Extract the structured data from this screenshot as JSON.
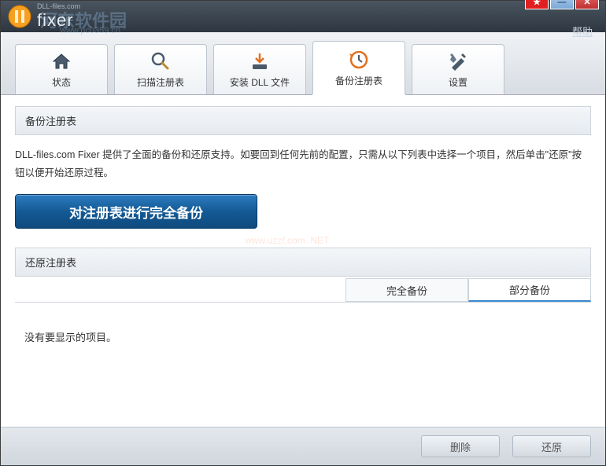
{
  "titlebar": {
    "brand_small": "DLL-files.com",
    "brand": "fixer",
    "help": "帮助"
  },
  "watermark": {
    "text": "河东软件园",
    "url": "www.pc0359.cn",
    "center": "www.uzzf.com .NET"
  },
  "tabs": {
    "status": "状态",
    "scan": "扫描注册表",
    "install": "安装 DLL 文件",
    "backup": "备份注册表",
    "settings": "设置"
  },
  "section": {
    "backup_title": "备份注册表",
    "description": "DLL-files.com Fixer 提供了全面的备份和还原支持。如要回到任何先前的配置，只需从以下列表中选择一个项目，然后单击\"还原\"按钮以便开始还原过程。",
    "full_backup_btn": "对注册表进行完全备份",
    "restore_title": "还原注册表",
    "tab_full": "完全备份",
    "tab_partial": "部分备份",
    "empty_msg": "没有要显示的项目。"
  },
  "buttons": {
    "delete": "删除",
    "restore": "还原"
  }
}
